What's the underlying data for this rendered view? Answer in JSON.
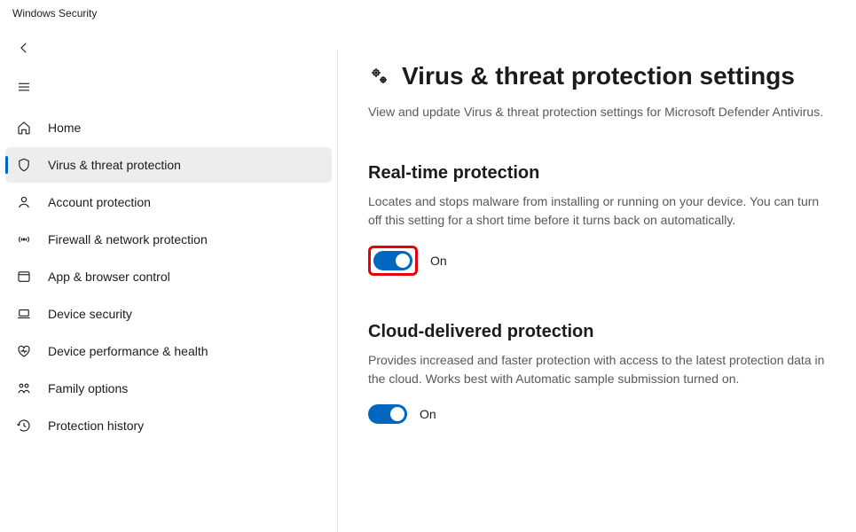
{
  "app_title": "Windows Security",
  "sidebar": {
    "items": [
      {
        "id": "home",
        "label": "Home"
      },
      {
        "id": "virus",
        "label": "Virus & threat protection"
      },
      {
        "id": "account",
        "label": "Account protection"
      },
      {
        "id": "firewall",
        "label": "Firewall & network protection"
      },
      {
        "id": "app",
        "label": "App & browser control"
      },
      {
        "id": "device",
        "label": "Device security"
      },
      {
        "id": "performance",
        "label": "Device performance & health"
      },
      {
        "id": "family",
        "label": "Family options"
      },
      {
        "id": "history",
        "label": "Protection history"
      }
    ]
  },
  "page": {
    "title": "Virus & threat protection settings",
    "subtitle": "View and update Virus & threat protection settings for Microsoft Defender Antivirus."
  },
  "sections": {
    "realtime": {
      "title": "Real-time protection",
      "desc": "Locates and stops malware from installing or running on your device. You can turn off this setting for a short time before it turns back on automatically.",
      "toggle_state": "On"
    },
    "cloud": {
      "title": "Cloud-delivered protection",
      "desc": "Provides increased and faster protection with access to the latest protection data in the cloud. Works best with Automatic sample submission turned on.",
      "toggle_state": "On"
    }
  }
}
